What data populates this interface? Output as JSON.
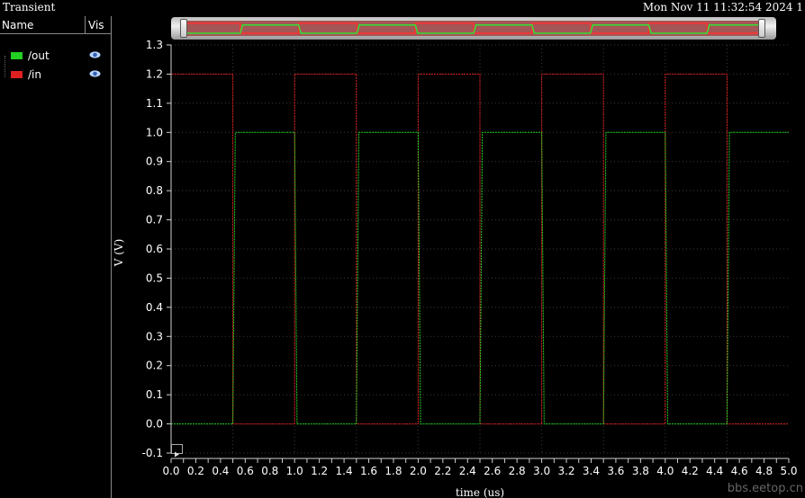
{
  "window": {
    "title": "Transient",
    "datetime": "Mon Nov 11 11:32:54 2024  1"
  },
  "legend_panel": {
    "col_name": "Name",
    "col_vis": "Vis",
    "items": [
      {
        "label": "/out",
        "color": "#22d022",
        "visible_icon": "eye-icon"
      },
      {
        "label": "/in",
        "color": "#e02020",
        "visible_icon": "eye-icon"
      }
    ]
  },
  "watermark": "bbs.eetop.cn",
  "chart_data": {
    "type": "line",
    "title": "",
    "xlabel": "time (us)",
    "ylabel": "V (V)",
    "xlim": [
      0.0,
      5.0
    ],
    "ylim": [
      -0.1,
      1.3
    ],
    "xticks": [
      0.0,
      0.1,
      0.2,
      0.3,
      0.4,
      0.5,
      0.6,
      0.7,
      0.8,
      0.9,
      1.0,
      1.1,
      1.2,
      1.3,
      1.4,
      1.5,
      1.6,
      1.7,
      1.8,
      1.9,
      2.0,
      2.1,
      2.2,
      2.3,
      2.4,
      2.5,
      2.6,
      2.7,
      2.8,
      2.9,
      3.0,
      3.1,
      3.2,
      3.3,
      3.4,
      3.5,
      3.6,
      3.7,
      3.8,
      3.9,
      4.0,
      4.1,
      4.2,
      4.3,
      4.4,
      4.5,
      4.6,
      4.7,
      4.8,
      4.9,
      5.0
    ],
    "xtick_labels": [
      "0.0",
      "0.2",
      "0.4",
      "0.6",
      "0.8",
      "1.0",
      "1.2",
      "1.4",
      "1.6",
      "1.8",
      "2.0",
      "2.2",
      "2.4",
      "2.6",
      "2.8",
      "3.0",
      "3.2",
      "3.4",
      "3.6",
      "3.8",
      "4.0",
      "4.2",
      "4.4",
      "4.6",
      "4.8",
      "5.0"
    ],
    "yticks": [
      -0.1,
      0.0,
      0.1,
      0.2,
      0.3,
      0.4,
      0.5,
      0.6,
      0.7,
      0.8,
      0.9,
      1.0,
      1.1,
      1.2,
      1.3
    ],
    "ytick_labels": [
      "-0.1",
      "0.0",
      "0.1",
      "0.2",
      "0.3",
      "0.4",
      "0.5",
      "0.6",
      "0.7",
      "0.8",
      "0.9",
      "1.0",
      "1.1",
      "1.2",
      "1.3"
    ],
    "grid": true,
    "series": [
      {
        "name": "/in",
        "color": "#e02020",
        "x": [
          0.0,
          0.0,
          0.5,
          0.5,
          1.0,
          1.0,
          1.5,
          1.5,
          2.0,
          2.0,
          2.5,
          2.5,
          3.0,
          3.0,
          3.5,
          3.5,
          4.0,
          4.0,
          4.5,
          4.5,
          5.0
        ],
        "y": [
          0.0,
          1.2,
          1.2,
          0.0,
          0.0,
          1.2,
          1.2,
          0.0,
          0.0,
          1.2,
          1.2,
          0.0,
          0.0,
          1.2,
          1.2,
          0.0,
          0.0,
          1.2,
          1.2,
          0.0,
          0.0
        ]
      },
      {
        "name": "/out",
        "color": "#22d022",
        "x": [
          0.0,
          0.5,
          0.52,
          1.0,
          1.02,
          1.5,
          1.52,
          2.0,
          2.02,
          2.5,
          2.52,
          3.0,
          3.02,
          3.5,
          3.52,
          4.0,
          4.02,
          4.5,
          4.52,
          5.0
        ],
        "y": [
          0.0,
          0.0,
          1.0,
          1.0,
          0.0,
          0.0,
          1.0,
          1.0,
          0.0,
          0.0,
          1.0,
          1.0,
          0.0,
          0.0,
          1.0,
          1.0,
          0.0,
          0.0,
          1.0,
          1.0
        ]
      }
    ]
  }
}
